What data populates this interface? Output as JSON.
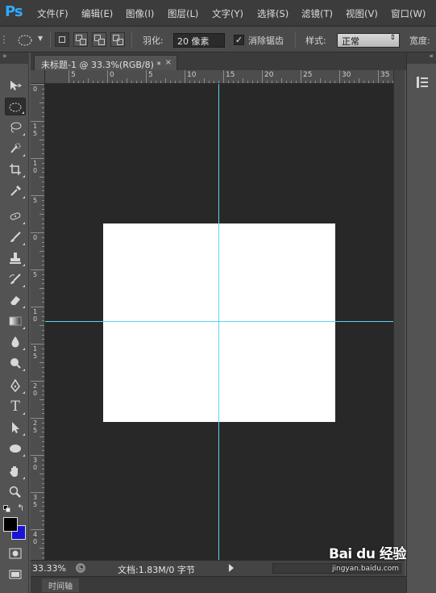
{
  "app": {
    "logo": "Ps"
  },
  "menu": [
    {
      "label": "文件(F)"
    },
    {
      "label": "编辑(E)"
    },
    {
      "label": "图像(I)"
    },
    {
      "label": "图层(L)"
    },
    {
      "label": "文字(Y)"
    },
    {
      "label": "选择(S)"
    },
    {
      "label": "滤镜(T)"
    },
    {
      "label": "视图(V)"
    },
    {
      "label": "窗口(W)"
    }
  ],
  "options": {
    "feather_label": "羽化:",
    "feather_value": "20 像素",
    "antialias_label": "消除锯齿",
    "antialias_checked": "✓",
    "style_label": "样式:",
    "style_value": "正常",
    "width_label": "宽度:"
  },
  "toolbar": {
    "collapse": "»",
    "tools": [
      {
        "name": "move-tool",
        "icon": "move-icon"
      },
      {
        "name": "elliptical-marquee-tool",
        "icon": "elliptical-marquee-icon",
        "selected": true
      },
      {
        "name": "lasso-tool",
        "icon": "lasso-icon"
      },
      {
        "name": "quick-selection-tool",
        "icon": "quick-selection-icon"
      },
      {
        "name": "crop-tool",
        "icon": "crop-icon"
      },
      {
        "name": "eyedropper-tool",
        "icon": "eyedropper-icon"
      },
      {
        "name": "spot-healing-tool",
        "icon": "healing-icon"
      },
      {
        "name": "brush-tool",
        "icon": "brush-icon"
      },
      {
        "name": "clone-stamp-tool",
        "icon": "stamp-icon"
      },
      {
        "name": "history-brush-tool",
        "icon": "history-brush-icon"
      },
      {
        "name": "eraser-tool",
        "icon": "eraser-icon"
      },
      {
        "name": "gradient-tool",
        "icon": "gradient-icon"
      },
      {
        "name": "blur-tool",
        "icon": "blur-icon"
      },
      {
        "name": "dodge-tool",
        "icon": "dodge-icon"
      },
      {
        "name": "pen-tool",
        "icon": "pen-icon"
      },
      {
        "name": "type-tool",
        "icon": "type-icon",
        "glyph": "T"
      },
      {
        "name": "path-selection-tool",
        "icon": "path-selection-icon"
      },
      {
        "name": "ellipse-tool",
        "icon": "ellipse-icon"
      },
      {
        "name": "hand-tool",
        "icon": "hand-icon"
      },
      {
        "name": "zoom-tool",
        "icon": "zoom-icon"
      }
    ],
    "foreground_color": "#000000",
    "background_color": "#1a14d4"
  },
  "document": {
    "tab_title": "未标题-1 @ 33.3%(RGB/8) *",
    "close": "×"
  },
  "ruler_top": [
    "5",
    "0",
    "5",
    "10",
    "15",
    "20",
    "25",
    "30",
    "35"
  ],
  "ruler_left": [
    "0",
    "1\n5",
    "1\n0",
    "5",
    "0",
    "5",
    "1\n0",
    "1\n5",
    "2\n0",
    "2\n5",
    "3\n0",
    "3\n5",
    "4\n0"
  ],
  "colors": {
    "guide": "#5fd3f0",
    "canvas_bg": "#282828",
    "document_bg": "#ffffff"
  },
  "status": {
    "zoom": "33.33%",
    "doc_info": "文档:1.83M/0 字节"
  },
  "timeline": {
    "label": "时间轴"
  },
  "right_dock": {
    "collapse": "«"
  },
  "watermark": {
    "main": "Bai du 经验",
    "sub": "jingyan.baidu.com"
  }
}
